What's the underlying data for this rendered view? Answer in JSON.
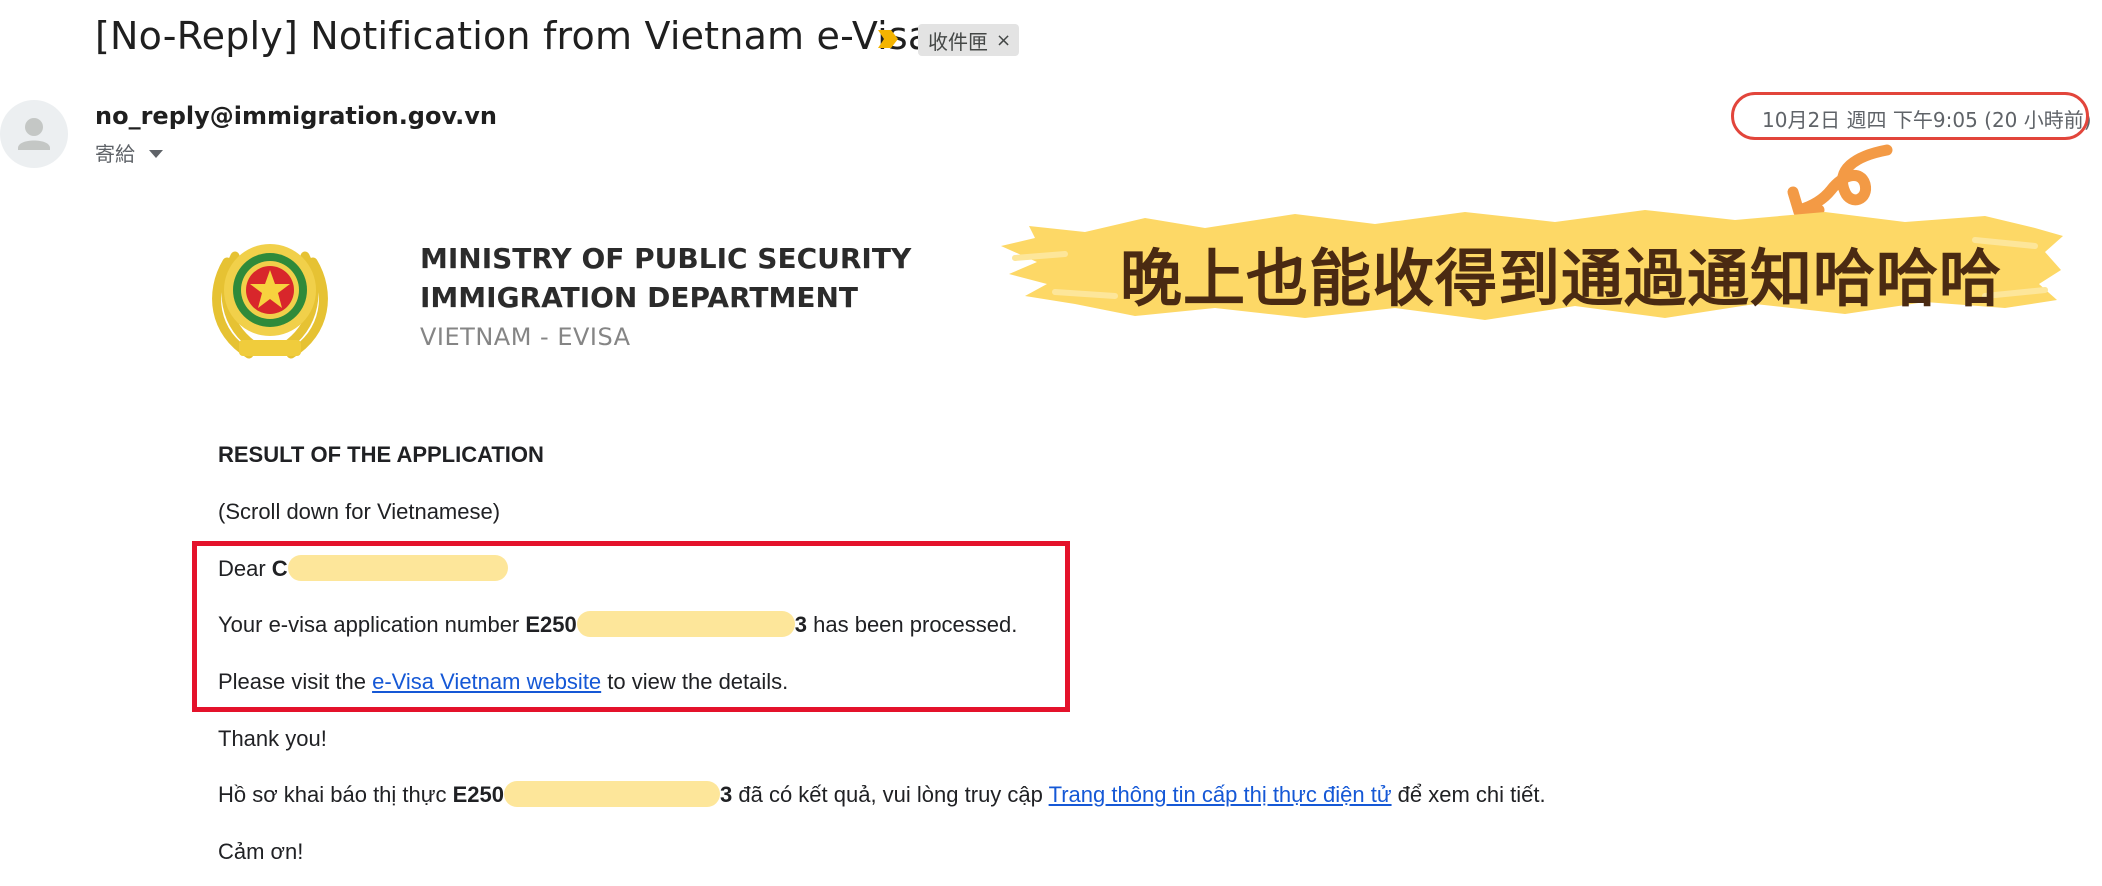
{
  "email": {
    "subject": "[No-Reply] Notification from Vietnam e-Visa",
    "label_chip": "收件匣",
    "chip_close": "×",
    "sender_email": "no_reply@immigration.gov.vn",
    "to_label": "寄給",
    "date": "10月2日 週四 下午9:05 (20 小時前)"
  },
  "annotation": {
    "banner_text": "晚上也能收得到通過通知哈哈哈",
    "accent_color": "#e4122b",
    "banner_color": "#fdd866"
  },
  "letter": {
    "header_line1": "MINISTRY OF PUBLIC SECURITY",
    "header_line2": "IMMIGRATION DEPARTMENT",
    "header_sub": "VIETNAM - EVISA",
    "result_title": "RESULT OF THE APPLICATION",
    "scroll_note": "(Scroll down for Vietnamese)",
    "dear_prefix": "Dear ",
    "dear_initial": "C",
    "app_prefix": "Your e-visa application number ",
    "app_number_start": "E250",
    "app_number_end": "3",
    "app_suffix": " has been processed.",
    "visit_prefix": "Please visit the ",
    "visit_link": " e-Visa Vietnam website",
    "visit_suffix": " to view the details.",
    "thanks": "Thank you!",
    "vn_prefix": "Hồ sơ khai báo thị thực ",
    "vn_number_start": "E250",
    "vn_number_end": "3",
    "vn_middle": " đã có kết quả, vui lòng truy cập ",
    "vn_link": "Trang thông tin cấp thị thực điện tử",
    "vn_suffix": " để xem chi tiết.",
    "vn_thanks": "Cảm ơn!"
  }
}
